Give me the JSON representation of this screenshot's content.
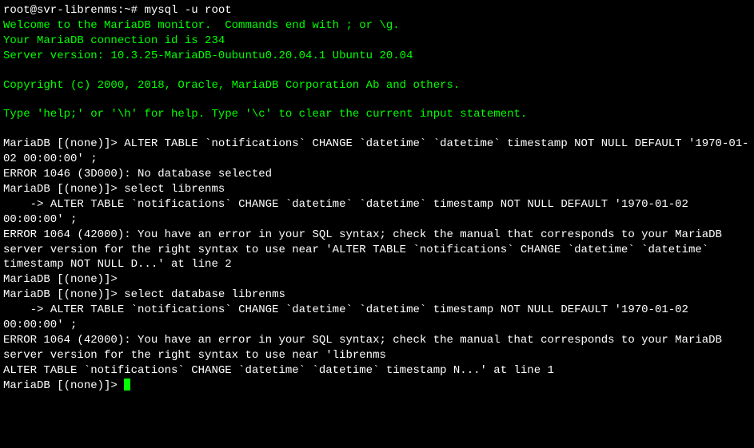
{
  "shell": {
    "prompt": "root@svr-librenms:~# ",
    "command": "mysql -u root"
  },
  "welcome": {
    "line1": "Welcome to the MariaDB monitor.  Commands end with ; or \\g.",
    "line2": "Your MariaDB connection id is 234",
    "line3": "Server version: 10.3.25-MariaDB-0ubuntu0.20.04.1 Ubuntu 20.04",
    "copyright": "Copyright (c) 2000, 2018, Oracle, MariaDB Corporation Ab and others.",
    "help": "Type 'help;' or '\\h' for help. Type '\\c' to clear the current input statement."
  },
  "session": {
    "prompt1": "MariaDB [(none)]> ",
    "cmd1": "ALTER TABLE `notifications` CHANGE `datetime` `datetime` timestamp NOT NULL DEFAULT '1970-01-02 00:00:00' ;",
    "err1": "ERROR 1046 (3D000): No database selected",
    "prompt2": "MariaDB [(none)]> ",
    "cmd2": "select librenms",
    "cont_prompt2": "    -> ",
    "cont_cmd2": "ALTER TABLE `notifications` CHANGE `datetime` `datetime` timestamp NOT NULL DEFAULT '1970-01-02 00:00:00' ;",
    "err2": "ERROR 1064 (42000): You have an error in your SQL syntax; check the manual that corresponds to your MariaDB server version for the right syntax to use near 'ALTER TABLE `notifications` CHANGE `datetime` `datetime` timestamp NOT NULL D...' at line 2",
    "prompt3": "MariaDB [(none)]>",
    "prompt4": "MariaDB [(none)]> ",
    "cmd4": "select database librenms",
    "cont_prompt4": "    -> ",
    "cont_cmd4": "ALTER TABLE `notifications` CHANGE `datetime` `datetime` timestamp NOT NULL DEFAULT '1970-01-02 00:00:00' ;",
    "err4": "ERROR 1064 (42000): You have an error in your SQL syntax; check the manual that corresponds to your MariaDB server version for the right syntax to use near 'librenms\nALTER TABLE `notifications` CHANGE `datetime` `datetime` timestamp N...' at line 1",
    "prompt5": "MariaDB [(none)]> "
  }
}
